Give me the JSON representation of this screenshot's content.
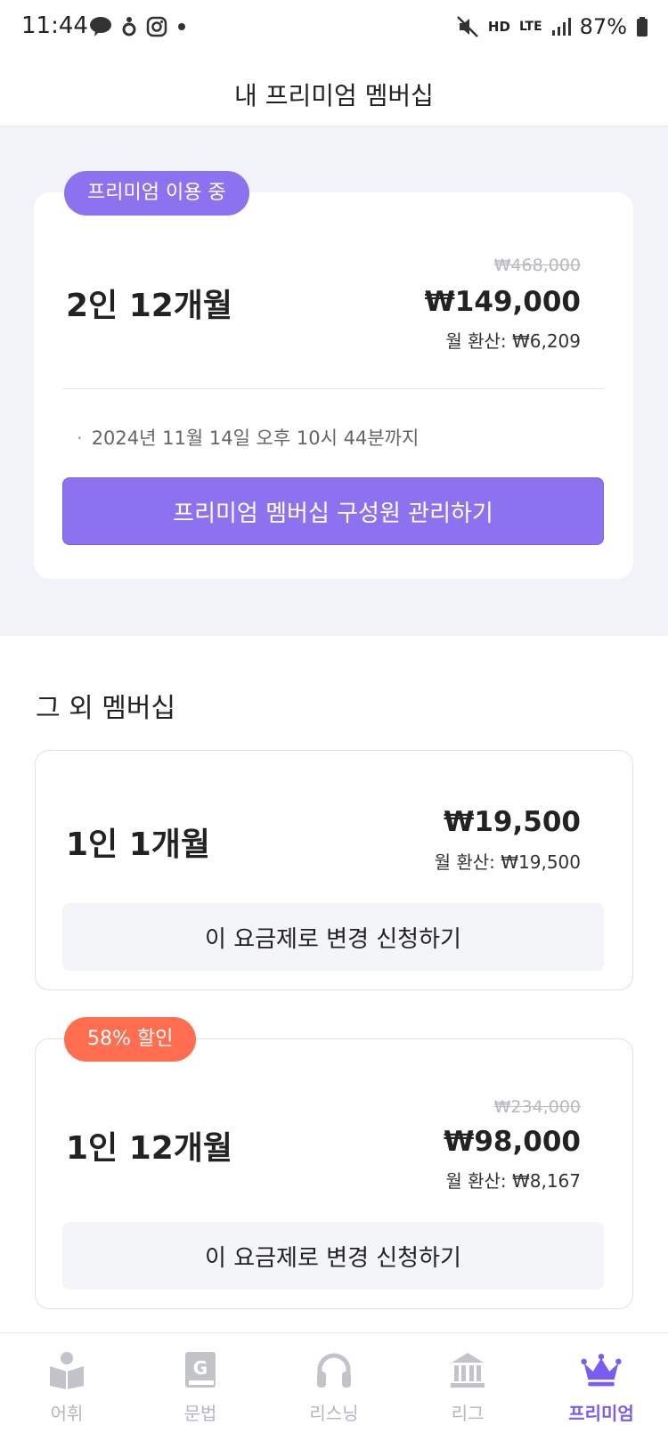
{
  "status_bar": {
    "time": "11:44",
    "battery": "87%",
    "network": "LTE",
    "hd_label": "HD"
  },
  "header": {
    "title": "내 프리미엄 멤버십"
  },
  "current_plan": {
    "badge": "프리미엄 이용 중",
    "name": "2인 12개월",
    "original_price": "₩468,000",
    "price": "₩149,000",
    "monthly": "월 환산: ₩6,209",
    "expiry_bullet": "·",
    "expiry": "2024년 11월 14일 오후 10시 44분까지",
    "manage_button": "프리미엄 멤버십 구성원 관리하기"
  },
  "other_section": {
    "title": "그 외 멤버십"
  },
  "plans": [
    {
      "name": "1인 1개월",
      "price": "₩19,500",
      "monthly": "월 환산: ₩19,500",
      "button": "이 요금제로 변경 신청하기"
    },
    {
      "badge": "58% 할인",
      "name": "1인 12개월",
      "original_price": "₩234,000",
      "price": "₩98,000",
      "monthly": "월 환산: ₩8,167",
      "button": "이 요금제로 변경 신청하기"
    }
  ],
  "nav": [
    {
      "label": "어휘",
      "icon": "book-reader-icon",
      "active": false
    },
    {
      "label": "문법",
      "icon": "grammar-book-icon",
      "active": false
    },
    {
      "label": "리스닝",
      "icon": "headphones-icon",
      "active": false
    },
    {
      "label": "리그",
      "icon": "building-icon",
      "active": false
    },
    {
      "label": "프리미엄",
      "icon": "crown-icon",
      "active": true
    }
  ],
  "colors": {
    "accent": "#8c72ef",
    "discount": "#ff6e50",
    "nav_active": "#7a5cf0",
    "nav_inactive": "#b5b7bd"
  }
}
